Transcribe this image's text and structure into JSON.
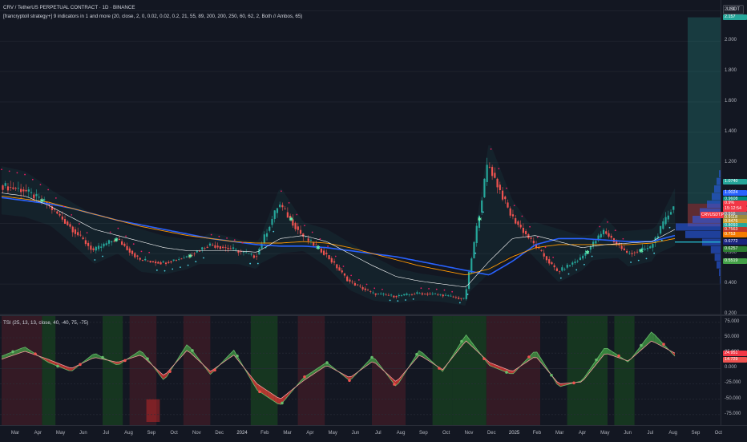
{
  "header": {
    "title": "CRV / TetherUS PERPETUAL CONTRACT · 1D · BINANCE",
    "indicator": "[francryptoll strategy+] 9 indicators in 1 and more (20, close, 2, 0, 0.02, 0.02, 0.2, 21, 55, 89, 200, 200, 250, 60, 62, 2, Both // Ambos, 65)",
    "currency": "USDT"
  },
  "tsi": {
    "label": "TSI (25, 13, 13, close, 40, -40, 75, -75)"
  },
  "colors": {
    "background": "#131722",
    "up": "#26a69a",
    "down": "#ef5350",
    "ema_fast": "#2962ff",
    "ema_slow": "#ff9800",
    "pink": "#e91e63",
    "zone_green": "#1b5e20",
    "zone_red": "#5d1f2a"
  },
  "price_labels": [
    {
      "text": "2.157",
      "color": "#26a69a",
      "value": 2.157
    },
    {
      "text": "1.0740",
      "color": "#26a69a",
      "value": 1.074
    },
    {
      "text": "1.0024",
      "color": "#2962ff",
      "value": 1.0024
    },
    {
      "text": "0.9608",
      "color": "#00897b",
      "value": 0.9608
    },
    {
      "text": "0.9%",
      "color": "#f23645",
      "value": 0.93
    },
    {
      "text": "15:12:54",
      "color": "#f23645",
      "value": 0.895
    },
    {
      "text": "0.916",
      "color": "#7a7a7a",
      "value": 0.86
    },
    {
      "text": "0.9118",
      "color": "#9c8a3a",
      "value": 0.835
    },
    {
      "text": "0.8476",
      "color": "#c69c2d",
      "value": 0.81
    },
    {
      "text": "0.8093",
      "color": "#26a69a",
      "value": 0.785
    },
    {
      "text": "0.7563",
      "color": "#c0392b",
      "value": 0.755
    },
    {
      "text": "0.753",
      "color": "#f57c00",
      "value": 0.725
    },
    {
      "text": "0.6772",
      "color": "#1a237e",
      "value": 0.677
    },
    {
      "text": "0.6257",
      "color": "#2e7d32",
      "value": 0.63
    },
    {
      "text": "0.5519",
      "color": "#43a047",
      "value": 0.5519
    }
  ],
  "symbol_tag": "CRVUSDT.P",
  "tsi_labels": [
    {
      "text": "24.951",
      "color": "#f23645",
      "value": 24.951
    },
    {
      "text": "14.729",
      "color": "#ef5350",
      "value": 14.729
    }
  ],
  "chart_data": [
    {
      "type": "line",
      "name_hint": "price",
      "ylim": [
        0.2,
        2.25
      ],
      "yticks": [
        2.2,
        2.0,
        1.8,
        1.6,
        1.4,
        1.2,
        1.0,
        0.8,
        0.6,
        0.4,
        0.2
      ],
      "ytick_labels": [
        "2.200",
        "2.000",
        "1.800",
        "1.600",
        "1.400",
        "1.200",
        "1.000",
        "0.800",
        "0.600",
        "0.400",
        "0.200"
      ],
      "x": [
        "2023-03",
        "2023-04",
        "2023-05",
        "2023-06",
        "2023-07",
        "2023-08",
        "2023-09",
        "2023-10",
        "2023-11",
        "2023-12",
        "2024-01",
        "2024-02",
        "2024-03",
        "2024-04",
        "2024-05",
        "2024-06",
        "2024-07",
        "2024-08",
        "2024-09",
        "2024-10",
        "2024-11",
        "2024-12",
        "2025-01",
        "2025-02",
        "2025-03",
        "2025-04",
        "2025-05",
        "2025-06",
        "2025-07",
        "2025-08"
      ],
      "series": [
        {
          "values": [
            1.05,
            1.02,
            0.93,
            0.78,
            0.62,
            0.7,
            0.56,
            0.54,
            0.58,
            0.66,
            0.63,
            0.58,
            0.93,
            0.72,
            0.6,
            0.42,
            0.34,
            0.32,
            0.34,
            0.33,
            0.3,
            1.2,
            0.85,
            0.66,
            0.48,
            0.57,
            0.75,
            0.6,
            0.64,
            0.92
          ]
        },
        {
          "values": [
            1.0,
            0.98,
            0.92,
            0.84,
            0.76,
            0.72,
            0.68,
            0.64,
            0.62,
            0.62,
            0.62,
            0.61,
            0.7,
            0.72,
            0.68,
            0.6,
            0.52,
            0.45,
            0.42,
            0.4,
            0.38,
            0.55,
            0.7,
            0.72,
            0.68,
            0.64,
            0.66,
            0.67,
            0.68,
            0.76
          ]
        },
        {
          "values": [
            0.98,
            0.96,
            0.94,
            0.9,
            0.86,
            0.82,
            0.78,
            0.75,
            0.72,
            0.7,
            0.68,
            0.67,
            0.67,
            0.68,
            0.67,
            0.64,
            0.6,
            0.56,
            0.52,
            0.49,
            0.46,
            0.5,
            0.58,
            0.64,
            0.66,
            0.66,
            0.66,
            0.66,
            0.67,
            0.7
          ]
        }
      ],
      "ema_values": [
        0.97,
        0.95,
        0.93,
        0.9,
        0.86,
        0.82,
        0.79,
        0.76,
        0.73,
        0.7,
        0.68,
        0.66,
        0.65,
        0.65,
        0.64,
        0.62,
        0.6,
        0.58,
        0.55,
        0.52,
        0.49,
        0.46,
        0.55,
        0.66,
        0.7,
        0.7,
        0.69,
        0.68,
        0.68,
        0.72
      ],
      "volume_profile": [
        0.02,
        0.03,
        0.05,
        0.1,
        0.14,
        0.22,
        0.4,
        0.75,
        0.95,
        0.6,
        0.45,
        0.3,
        0.2,
        0.15,
        0.1,
        0.05
      ]
    },
    {
      "type": "area",
      "name_hint": "tsi",
      "ylim": [
        -87,
        80
      ],
      "yticks": [
        75,
        50,
        25,
        0,
        -25,
        -50,
        -75
      ],
      "ytick_labels": [
        "75.000",
        "50.000",
        "25.000",
        "0.000",
        "-25.000",
        "-50.000",
        "-75.000"
      ],
      "tsi_values": [
        20,
        35,
        10,
        -5,
        25,
        5,
        30,
        -20,
        40,
        -10,
        30,
        -35,
        -60,
        -15,
        10,
        -20,
        20,
        -30,
        30,
        -5,
        55,
        5,
        -10,
        30,
        -30,
        -20,
        35,
        10,
        60,
        20
      ],
      "signal_values": [
        15,
        28,
        15,
        0,
        18,
        10,
        22,
        -12,
        30,
        -5,
        22,
        -25,
        -50,
        -20,
        5,
        -15,
        12,
        -22,
        22,
        -2,
        45,
        10,
        -5,
        20,
        -25,
        -22,
        25,
        12,
        45,
        25
      ],
      "zones": [
        {
          "from": 0.0,
          "to": 0.06,
          "kind": "red"
        },
        {
          "from": 0.06,
          "to": 0.08,
          "kind": "green"
        },
        {
          "from": 0.15,
          "to": 0.18,
          "kind": "green"
        },
        {
          "from": 0.19,
          "to": 0.23,
          "kind": "red"
        },
        {
          "from": 0.27,
          "to": 0.31,
          "kind": "red"
        },
        {
          "from": 0.37,
          "to": 0.41,
          "kind": "green"
        },
        {
          "from": 0.44,
          "to": 0.48,
          "kind": "red"
        },
        {
          "from": 0.55,
          "to": 0.6,
          "kind": "red"
        },
        {
          "from": 0.64,
          "to": 0.67,
          "kind": "green"
        },
        {
          "from": 0.67,
          "to": 0.72,
          "kind": "green"
        },
        {
          "from": 0.72,
          "to": 0.8,
          "kind": "red"
        },
        {
          "from": 0.84,
          "to": 0.9,
          "kind": "green"
        },
        {
          "from": 0.91,
          "to": 0.94,
          "kind": "green"
        }
      ]
    }
  ],
  "time_axis": {
    "labels": [
      "Mar",
      "Apr",
      "May",
      "Jun",
      "Jul",
      "Aug",
      "Sep",
      "Oct",
      "Nov",
      "Dec",
      "2024",
      "Feb",
      "Mar",
      "Apr",
      "May",
      "Jun",
      "Jul",
      "Aug",
      "Sep",
      "Oct",
      "Nov",
      "Dec",
      "2025",
      "Feb",
      "Mar",
      "Apr",
      "May",
      "Jun",
      "Jul",
      "Aug",
      "Sep",
      "Oct"
    ]
  }
}
